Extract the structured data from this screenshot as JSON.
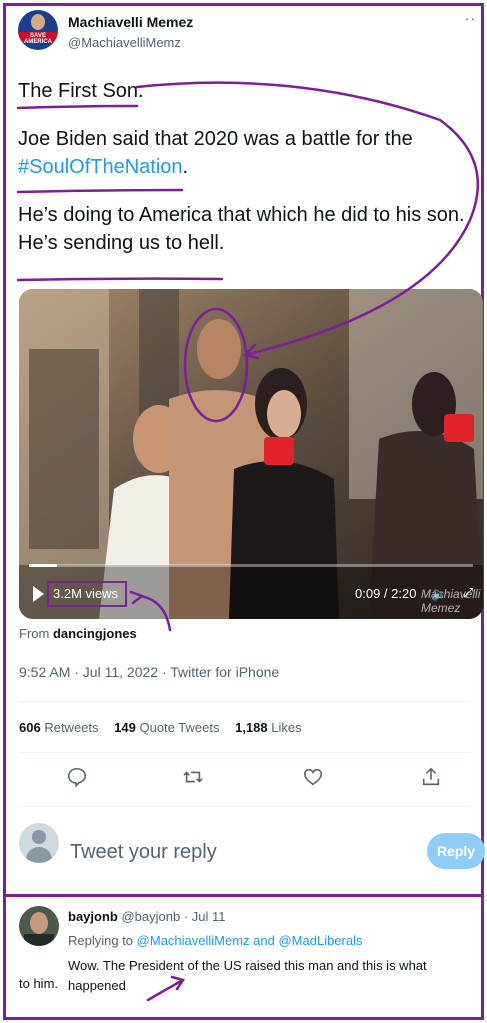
{
  "author": {
    "display_name": "Machiavelli Memez",
    "handle": "@MachiavelliMemz",
    "avatar_text": "SAVE AMERICA",
    "avatar_icon": "user-avatar-icon"
  },
  "tweet": {
    "line1": "The First Son.",
    "line2": "Joe Biden said that 2020 was a battle for the",
    "hashtag": "#SoulOfTheNation",
    "hashtag_tail": ".",
    "line3": "He’s doing to America that which he did to his son.",
    "line4": "He’s sending us to hell."
  },
  "video": {
    "views": "3.2M views",
    "timecode": "0:09 / 2:20",
    "watermark": "Machiavelli Memez",
    "from_label": "From",
    "from_user": "dancingjones"
  },
  "meta": "9:52 AM · Jul 11, 2022 · Twitter for iPhone",
  "stats": {
    "retweets_count": "606",
    "retweets_label": "Retweets",
    "quote_count": "149",
    "quote_label": "Quote Tweets",
    "likes_count": "1,188",
    "likes_label": "Likes"
  },
  "actions": [
    "reply-icon",
    "retweet-icon",
    "like-icon",
    "share-icon"
  ],
  "reply_box": {
    "placeholder": "Tweet your reply",
    "button": "Reply"
  },
  "comment": {
    "display_name": "bayjonb",
    "handle_date": "@bayjonb · Jul 11",
    "replying_prefix": "Replying to",
    "replying_users": "@MachiavelliMemz and @MadLiberals",
    "text_line1": "Wow. The President of the US raised this man and this is what happened",
    "text_line2": "to him."
  },
  "colors": {
    "annotation": "#7b1f9b",
    "link": "#1d9bf0",
    "reply_button": "#8ecdf8",
    "muted": "#536471"
  }
}
